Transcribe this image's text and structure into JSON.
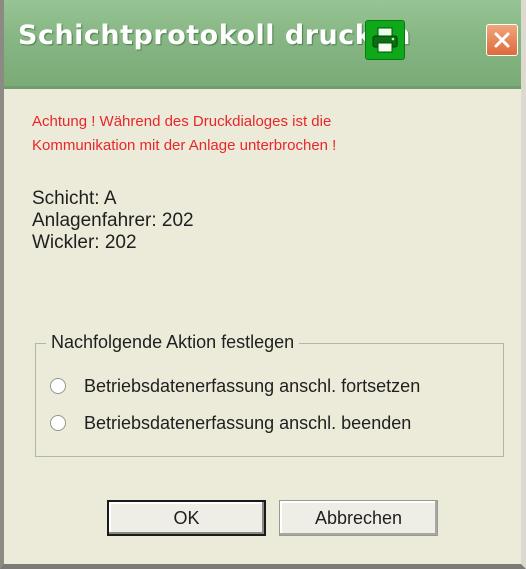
{
  "window": {
    "title": "Schichtprotokoll drucken",
    "title_icon": "printer-icon",
    "close_icon": "close-icon"
  },
  "warning": {
    "line1": "Achtung ! Während des Druckdialoges ist die",
    "line2": "Kommunikation mit der Anlage unterbrochen !"
  },
  "info": {
    "shift": "Schicht: A",
    "operator": "Anlagenfahrer: 202",
    "winder": "Wickler: 202"
  },
  "action_group": {
    "legend": "Nachfolgende Aktion festlegen",
    "options": [
      "Betriebsdatenerfassung anschl. fortsetzen",
      "Betriebsdatenerfassung anschl. beenden"
    ]
  },
  "buttons": {
    "ok": "OK",
    "cancel": "Abbrechen"
  },
  "colors": {
    "titlebar": "#86b683",
    "warning_text": "#e8272b",
    "dialog_background": "#ecead9",
    "close_button": "#dd6a3c"
  }
}
